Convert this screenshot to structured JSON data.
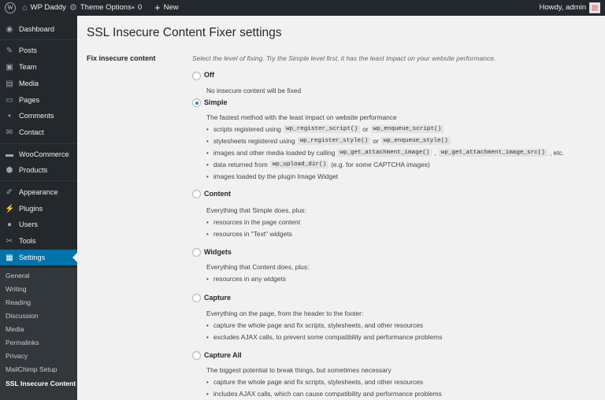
{
  "adminbar": {
    "site_name": "WP Daddy",
    "theme_options": "Theme Options",
    "comments_count": "0",
    "new_label": "New",
    "howdy": "Howdy, admin"
  },
  "sidebar": {
    "items": [
      {
        "label": "Dashboard",
        "icon": "dashboard-icon"
      },
      {
        "label": "Posts",
        "icon": "pin-icon"
      },
      {
        "label": "Team",
        "icon": "team-icon"
      },
      {
        "label": "Media",
        "icon": "media-icon"
      },
      {
        "label": "Pages",
        "icon": "pages-icon"
      },
      {
        "label": "Comments",
        "icon": "comment-icon"
      },
      {
        "label": "Contact",
        "icon": "mail-icon"
      },
      {
        "label": "WooCommerce",
        "icon": "woocommerce-icon"
      },
      {
        "label": "Products",
        "icon": "products-icon"
      },
      {
        "label": "Appearance",
        "icon": "brush-icon"
      },
      {
        "label": "Plugins",
        "icon": "plugin-icon"
      },
      {
        "label": "Users",
        "icon": "user-icon"
      },
      {
        "label": "Tools",
        "icon": "wrench-icon"
      },
      {
        "label": "Settings",
        "icon": "settings-icon"
      }
    ],
    "submenu": [
      "General",
      "Writing",
      "Reading",
      "Discussion",
      "Media",
      "Permalinks",
      "Privacy",
      "MailChimp Setup",
      "SSL Insecure Content"
    ],
    "active_color": "#0073aa"
  },
  "page": {
    "title": "SSL Insecure Content Fixer settings",
    "field_label": "Fix insecure content",
    "field_description": "Select the level of fixing. Try the Simple level first, it has the least impact on your website performance."
  },
  "options": {
    "off": {
      "label": "Off",
      "intro": "No insecure content will be fixed"
    },
    "simple": {
      "label": "Simple",
      "intro": "The fastest method with the least impact on website performance",
      "b1_pre": "scripts registered using",
      "b1_code1": "wp_register_script()",
      "b1_or": "or",
      "b1_code2": "wp_enqueue_script()",
      "b2_pre": "stylesheets registered using",
      "b2_code1": "wp_register_style()",
      "b2_or": "or",
      "b2_code2": "wp_enqueue_style()",
      "b3_pre": "images and other media loaded by calling",
      "b3_code1": "wp_get_attachment_image()",
      "b3_sep": ",",
      "b3_code2": "wp_get_attachment_image_src()",
      "b3_post": ", etc.",
      "b4_pre": "data returned from",
      "b4_code": "wp_upload_dir()",
      "b4_post": "(e.g. for some CAPTCHA images)",
      "b5": "images loaded by the plugin Image Widget"
    },
    "content": {
      "label": "Content",
      "intro": "Everything that Simple does, plus:",
      "b1": "resources in the page content",
      "b2": "resources in \"Text\" widgets"
    },
    "widgets": {
      "label": "Widgets",
      "intro": "Everything that Content does, plus:",
      "b1": "resources in any widgets"
    },
    "capture": {
      "label": "Capture",
      "intro": "Everything on the page, from the header to the footer:",
      "b1": "capture the whole page and fix scripts, stylesheets, and other resources",
      "b2": "excludes AJAX calls, to prevent some compatibility and performance problems"
    },
    "capture_all": {
      "label": "Capture All",
      "intro": "The biggest potential to break things, but sometimes necessary",
      "b1": "capture the whole page and fix scripts, stylesheets, and other resources",
      "b2": "includes AJAX calls, which can cause compatibility and performance problems"
    }
  }
}
